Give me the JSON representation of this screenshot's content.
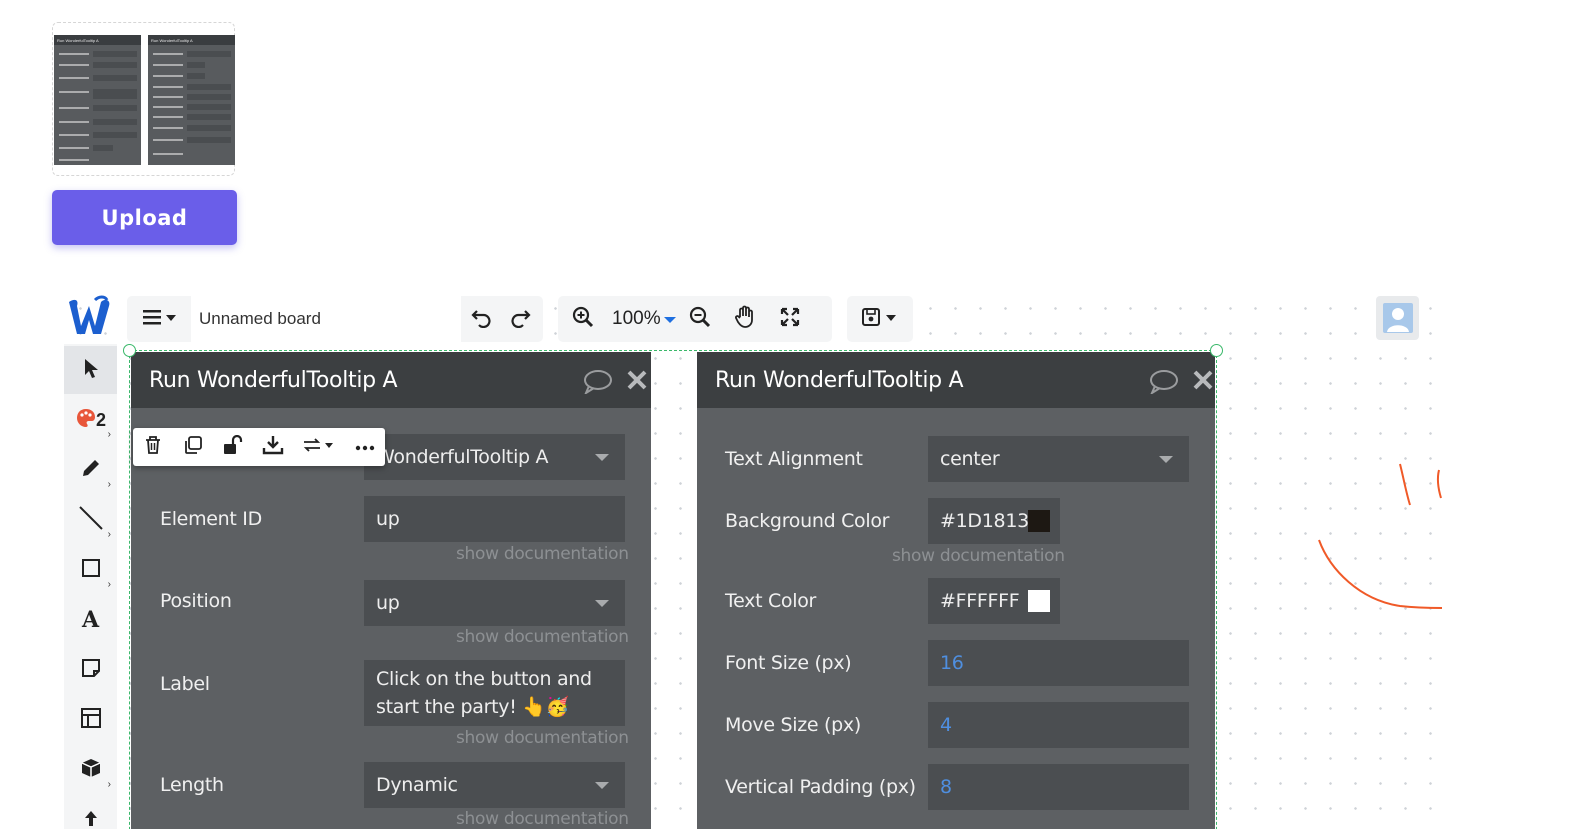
{
  "upload": {
    "label": "Upload"
  },
  "thumbnail": {
    "left_title": "Run WonderfulTooltip A",
    "right_title": "Run WonderfulTooltip A"
  },
  "toolbar": {
    "board_name": "Unnamed board",
    "zoom": "100%"
  },
  "tools": {
    "palette_count": "2"
  },
  "panel_left": {
    "title": "Run WonderfulTooltip A",
    "element_value": "WonderfulTooltip A",
    "rows": [
      {
        "label": "Element ID",
        "value": "up",
        "doc": "show documentation"
      },
      {
        "label": "Position",
        "value": "up",
        "doc": "show documentation"
      },
      {
        "label": "Label",
        "value_line1": "Click on the button and",
        "value_line2": "start the party! 👆🥳",
        "doc": "show documentation"
      },
      {
        "label": "Length",
        "value": "Dynamic",
        "doc": "show documentation"
      }
    ]
  },
  "panel_right": {
    "title": "Run WonderfulTooltip A",
    "rows": [
      {
        "label": "Text Alignment",
        "value": "center"
      },
      {
        "label": "Background Color",
        "value": "#1D1813",
        "doc": "show documentation"
      },
      {
        "label": "Text Color",
        "value": "#FFFFFF"
      },
      {
        "label": "Font Size (px)",
        "value": "16"
      },
      {
        "label": "Move Size (px)",
        "value": "4"
      },
      {
        "label": "Vertical Padding (px)",
        "value": "8"
      }
    ]
  },
  "colors": {
    "accent": "#6a5ee9",
    "panel_bg": "#5d6063",
    "panel_header": "#3c3f41",
    "field_bg": "#4b4e51",
    "selection": "#3ab86a",
    "swatch_bg": "#1D1813",
    "swatch_text": "#FFFFFF",
    "sketch": "#f05a28"
  }
}
